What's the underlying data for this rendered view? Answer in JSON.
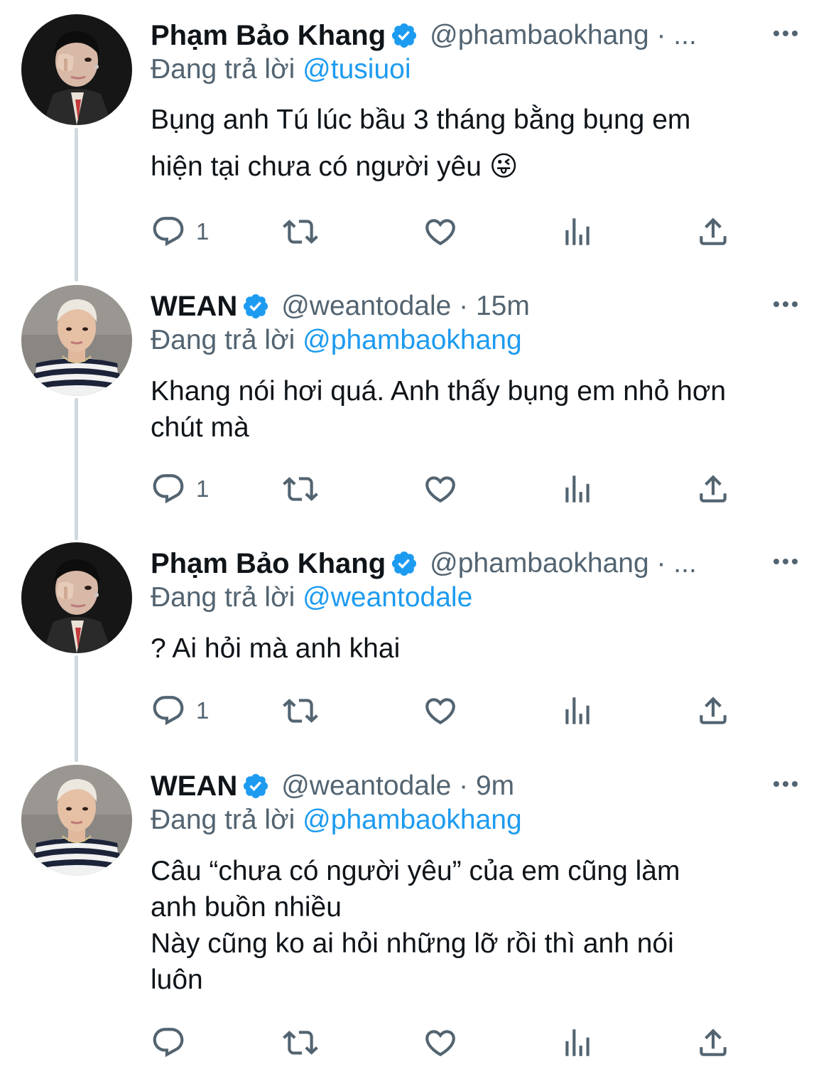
{
  "colors": {
    "accent": "#1d9bf0",
    "muted": "#536471",
    "text": "#0f1419",
    "thread_line": "#cfd9de"
  },
  "replying_prefix": "Đang trả lời",
  "tweets": [
    {
      "name": "Phạm Bảo Khang",
      "verified": true,
      "handle_line": "@phambaokhang · ...",
      "replying_to": "@tusiuoi",
      "lines": [
        "Bụng anh Tú lúc bầu 3 tháng bằng bụng em",
        "hiện tại chưa có người yêu 😜"
      ],
      "reply_count": "1",
      "avatar": "phambaokhang"
    },
    {
      "name": "WEAN",
      "verified": true,
      "handle_line": "@weantodale · 15m",
      "replying_to": "@phambaokhang",
      "lines": [
        "Khang nói hơi quá. Anh thấy bụng em nhỏ hơn",
        "chút mà"
      ],
      "reply_count": "1",
      "avatar": "weantodale"
    },
    {
      "name": "Phạm Bảo Khang",
      "verified": true,
      "handle_line": "@phambaokhang · ...",
      "replying_to": "@weantodale",
      "lines": [
        "? Ai hỏi mà anh khai"
      ],
      "reply_count": "1",
      "avatar": "phambaokhang"
    },
    {
      "name": "WEAN",
      "verified": true,
      "handle_line": "@weantodale · 9m",
      "replying_to": "@phambaokhang",
      "lines": [
        "Câu “chưa có người yêu” của em cũng làm",
        "anh buồn nhiều",
        "Này cũng ko ai hỏi những lỡ rồi thì anh nói",
        "luôn"
      ],
      "reply_count": "",
      "avatar": "weantodale"
    }
  ],
  "icons": [
    "reply-icon",
    "retweet-icon",
    "like-icon",
    "views-icon",
    "share-icon",
    "more-icon",
    "verified-badge-icon"
  ]
}
